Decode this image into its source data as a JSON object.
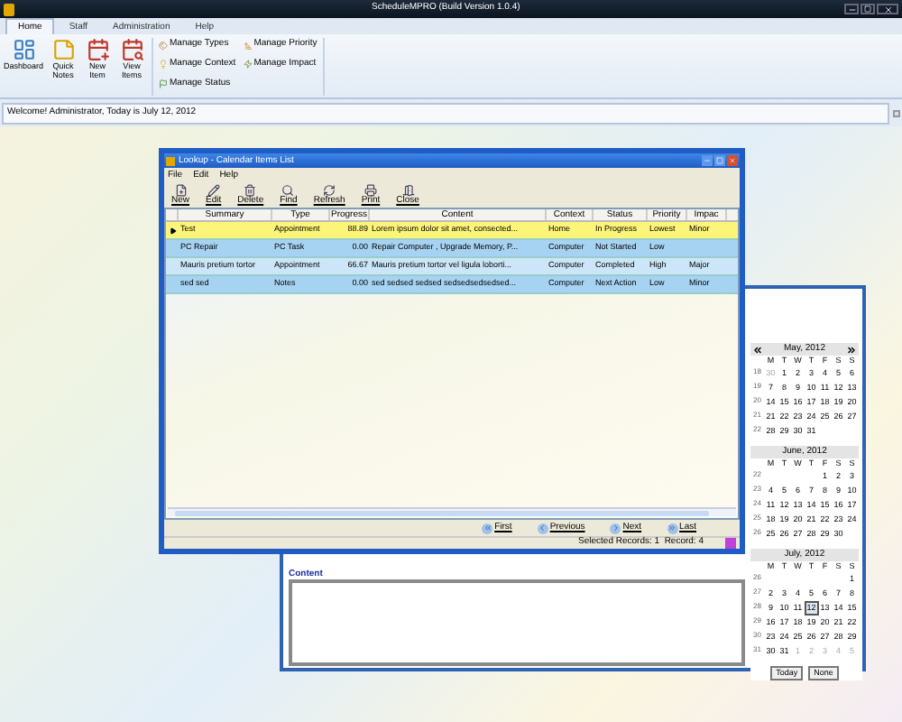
{
  "app": {
    "title": "ScheduleMPRO (Build Version 1.0.4)"
  },
  "ribbon_tabs": [
    {
      "label": "Home",
      "selected": true
    },
    {
      "label": "Staff",
      "selected": false
    },
    {
      "label": "Administration",
      "selected": false
    },
    {
      "label": "Help",
      "selected": false
    }
  ],
  "large_buttons": [
    {
      "label": "Dashboard",
      "kind": "dashboard"
    },
    {
      "label": "Quick Notes",
      "kind": "notes"
    },
    {
      "label": "New Item",
      "kind": "new"
    },
    {
      "label": "View Items",
      "kind": "view"
    }
  ],
  "small_buttons": [
    {
      "label": "Manage Types",
      "kind": "types"
    },
    {
      "label": "Manage Context",
      "kind": "context"
    },
    {
      "label": "Manage Status",
      "kind": "status"
    },
    {
      "label": "Manage Priority",
      "kind": "priority"
    },
    {
      "label": "Manage Impact",
      "kind": "impact"
    }
  ],
  "welcome": "Welcome! Administrator, Today is July 12, 2012",
  "lookup": {
    "title": "Lookup - Calendar Items List",
    "menu": [
      "File",
      "Edit",
      "Help"
    ],
    "toolbar": [
      {
        "label": "New",
        "kind": "new"
      },
      {
        "label": "Edit",
        "kind": "edit"
      },
      {
        "label": "Delete",
        "kind": "delete"
      },
      {
        "label": "Find",
        "kind": "find"
      },
      {
        "label": "Refresh",
        "kind": "refresh"
      },
      {
        "label": "Print",
        "kind": "print"
      },
      {
        "label": "Close",
        "kind": "close"
      }
    ],
    "columns": [
      "Summary",
      "Type",
      "Progress",
      "Content",
      "Context",
      "Status",
      "Priority",
      "Impac"
    ],
    "rows": [
      {
        "selected": true,
        "cells": [
          "Test",
          "Appointment",
          "88.89",
          "Lorem ipsum dolor sit amet, consected...",
          "Home",
          "In Progress",
          "Lowest",
          "Minor"
        ]
      },
      {
        "selected": false,
        "cells": [
          "PC Repair",
          "PC Task",
          "0.00",
          "Repair Computer , Upgrade Memory, P...",
          "Computer",
          "Not Started",
          "Low"
        ]
      },
      {
        "selected": false,
        "cells": [
          "Mauris pretium tortor",
          "Appointment",
          "66.67",
          "Mauris pretium tortor vel ligula loborti...",
          "Computer",
          "Completed",
          "High",
          "Major"
        ]
      },
      {
        "selected": false,
        "cells": [
          "sed sed",
          "Notes",
          "0.00",
          "sed sedsed sedsed sedsedsedsedsed...",
          "Computer",
          "Next Action",
          "Low",
          "Minor"
        ]
      }
    ],
    "nav": [
      {
        "label": "First",
        "kind": "first"
      },
      {
        "label": "Previous",
        "kind": "previous"
      },
      {
        "label": "Next",
        "kind": "next"
      },
      {
        "label": "Last",
        "kind": "last"
      }
    ],
    "status": "Selected Records: 1  Record: 4"
  },
  "content_panel": {
    "label": "Content"
  },
  "calendar": {
    "months": [
      {
        "title": "May, 2012",
        "navigation": true,
        "weekdays": [
          "M",
          "T",
          "W",
          "T",
          "F",
          "S",
          "S"
        ],
        "weeks": [
          {
            "number": "18",
            "days": [
              {
                "day": "30",
                "muted": true,
                "selected": false
              },
              {
                "day": "1",
                "muted": false,
                "selected": false
              },
              {
                "day": "2",
                "muted": false,
                "selected": false
              },
              {
                "day": "3",
                "muted": false,
                "selected": false
              },
              {
                "day": "4",
                "muted": false,
                "selected": false
              },
              {
                "day": "5",
                "muted": false,
                "selected": false
              },
              {
                "day": "6",
                "muted": false,
                "selected": false
              }
            ]
          },
          {
            "number": "19",
            "days": [
              {
                "day": "7",
                "muted": false,
                "selected": false
              },
              {
                "day": "8",
                "muted": false,
                "selected": false
              },
              {
                "day": "9",
                "muted": false,
                "selected": false
              },
              {
                "day": "10",
                "muted": false,
                "selected": false
              },
              {
                "day": "11",
                "muted": false,
                "selected": false
              },
              {
                "day": "12",
                "muted": false,
                "selected": false
              },
              {
                "day": "13",
                "muted": false,
                "selected": false
              }
            ]
          },
          {
            "number": "20",
            "days": [
              {
                "day": "14",
                "muted": false,
                "selected": false
              },
              {
                "day": "15",
                "muted": false,
                "selected": false
              },
              {
                "day": "16",
                "muted": false,
                "selected": false
              },
              {
                "day": "17",
                "muted": false,
                "selected": false
              },
              {
                "day": "18",
                "muted": false,
                "selected": false
              },
              {
                "day": "19",
                "muted": false,
                "selected": false
              },
              {
                "day": "20",
                "muted": false,
                "selected": false
              }
            ]
          },
          {
            "number": "21",
            "days": [
              {
                "day": "21",
                "muted": false,
                "selected": false
              },
              {
                "day": "22",
                "muted": false,
                "selected": false
              },
              {
                "day": "23",
                "muted": false,
                "selected": false
              },
              {
                "day": "24",
                "muted": false,
                "selected": false
              },
              {
                "day": "25",
                "muted": false,
                "selected": false
              },
              {
                "day": "26",
                "muted": false,
                "selected": false
              },
              {
                "day": "27",
                "muted": false,
                "selected": false
              }
            ]
          },
          {
            "number": "22",
            "days": [
              {
                "day": "28",
                "muted": false,
                "selected": false
              },
              {
                "day": "29",
                "muted": false,
                "selected": false
              },
              {
                "day": "30",
                "muted": false,
                "selected": false
              },
              {
                "day": "31",
                "muted": false,
                "selected": false
              }
            ]
          }
        ]
      },
      {
        "title": "June, 2012",
        "navigation": false,
        "weekdays": [
          "M",
          "T",
          "W",
          "T",
          "F",
          "S",
          "S"
        ],
        "weeks": [
          {
            "number": "22",
            "days": [
              {
                "day": "1",
                "muted": false,
                "selected": false
              },
              {
                "day": "2",
                "muted": false,
                "selected": false
              },
              {
                "day": "3",
                "muted": false,
                "selected": false
              }
            ]
          },
          {
            "number": "23",
            "days": [
              {
                "day": "4",
                "muted": false,
                "selected": false
              },
              {
                "day": "5",
                "muted": false,
                "selected": false
              },
              {
                "day": "6",
                "muted": false,
                "selected": false
              },
              {
                "day": "7",
                "muted": false,
                "selected": false
              },
              {
                "day": "8",
                "muted": false,
                "selected": false
              },
              {
                "day": "9",
                "muted": false,
                "selected": false
              },
              {
                "day": "10",
                "muted": false,
                "selected": false
              }
            ]
          },
          {
            "number": "24",
            "days": [
              {
                "day": "11",
                "muted": false,
                "selected": false
              },
              {
                "day": "12",
                "muted": false,
                "selected": false
              },
              {
                "day": "13",
                "muted": false,
                "selected": false
              },
              {
                "day": "14",
                "muted": false,
                "selected": false
              },
              {
                "day": "15",
                "muted": false,
                "selected": false
              },
              {
                "day": "16",
                "muted": false,
                "selected": false
              },
              {
                "day": "17",
                "muted": false,
                "selected": false
              }
            ]
          },
          {
            "number": "25",
            "days": [
              {
                "day": "18",
                "muted": false,
                "selected": false
              },
              {
                "day": "19",
                "muted": false,
                "selected": false
              },
              {
                "day": "20",
                "muted": false,
                "selected": false
              },
              {
                "day": "21",
                "muted": false,
                "selected": false
              },
              {
                "day": "22",
                "muted": false,
                "selected": false
              },
              {
                "day": "23",
                "muted": false,
                "selected": false
              },
              {
                "day": "24",
                "muted": false,
                "selected": false
              }
            ]
          },
          {
            "number": "26",
            "days": [
              {
                "day": "25",
                "muted": false,
                "selected": false
              },
              {
                "day": "26",
                "muted": false,
                "selected": false
              },
              {
                "day": "27",
                "muted": false,
                "selected": false
              },
              {
                "day": "28",
                "muted": false,
                "selected": false
              },
              {
                "day": "29",
                "muted": false,
                "selected": false
              },
              {
                "day": "30",
                "muted": false,
                "selected": false
              }
            ]
          }
        ]
      },
      {
        "title": "July, 2012",
        "navigation": false,
        "weekdays": [
          "M",
          "T",
          "W",
          "T",
          "F",
          "S",
          "S"
        ],
        "weeks": [
          {
            "number": "26",
            "days": [
              {
                "day": "1",
                "muted": false,
                "selected": false
              }
            ]
          },
          {
            "number": "27",
            "days": [
              {
                "day": "2",
                "muted": false,
                "selected": false
              },
              {
                "day": "3",
                "muted": false,
                "selected": false
              },
              {
                "day": "4",
                "muted": false,
                "selected": false
              },
              {
                "day": "5",
                "muted": false,
                "selected": false
              },
              {
                "day": "6",
                "muted": false,
                "selected": false
              },
              {
                "day": "7",
                "muted": false,
                "selected": false
              },
              {
                "day": "8",
                "muted": false,
                "selected": false
              }
            ]
          },
          {
            "number": "28",
            "days": [
              {
                "day": "9",
                "muted": false,
                "selected": false
              },
              {
                "day": "10",
                "muted": false,
                "selected": false
              },
              {
                "day": "11",
                "muted": false,
                "selected": false
              },
              {
                "day": "12",
                "muted": false,
                "selected": true
              },
              {
                "day": "13",
                "muted": false,
                "selected": false
              },
              {
                "day": "14",
                "muted": false,
                "selected": false
              },
              {
                "day": "15",
                "muted": false,
                "selected": false
              }
            ]
          },
          {
            "number": "29",
            "days": [
              {
                "day": "16",
                "muted": false,
                "selected": false
              },
              {
                "day": "17",
                "muted": false,
                "selected": false
              },
              {
                "day": "18",
                "muted": false,
                "selected": false
              },
              {
                "day": "19",
                "muted": false,
                "selected": false
              },
              {
                "day": "20",
                "muted": false,
                "selected": false
              },
              {
                "day": "21",
                "muted": false,
                "selected": false
              },
              {
                "day": "22",
                "muted": false,
                "selected": false
              }
            ]
          },
          {
            "number": "30",
            "days": [
              {
                "day": "23",
                "muted": false,
                "selected": false
              },
              {
                "day": "24",
                "muted": false,
                "selected": false
              },
              {
                "day": "25",
                "muted": false,
                "selected": false
              },
              {
                "day": "26",
                "muted": false,
                "selected": false
              },
              {
                "day": "27",
                "muted": false,
                "selected": false
              },
              {
                "day": "28",
                "muted": false,
                "selected": false
              },
              {
                "day": "29",
                "muted": false,
                "selected": false
              }
            ]
          },
          {
            "number": "31",
            "days": [
              {
                "day": "30",
                "muted": false,
                "selected": false
              },
              {
                "day": "31",
                "muted": false,
                "selected": false
              },
              {
                "day": "1",
                "muted": true,
                "selected": false
              },
              {
                "day": "2",
                "muted": true,
                "selected": false
              },
              {
                "day": "3",
                "muted": true,
                "selected": false
              },
              {
                "day": "4",
                "muted": true,
                "selected": false
              },
              {
                "day": "5",
                "muted": true,
                "selected": false
              }
            ]
          }
        ]
      }
    ],
    "buttons": [
      "Today",
      "None"
    ]
  }
}
